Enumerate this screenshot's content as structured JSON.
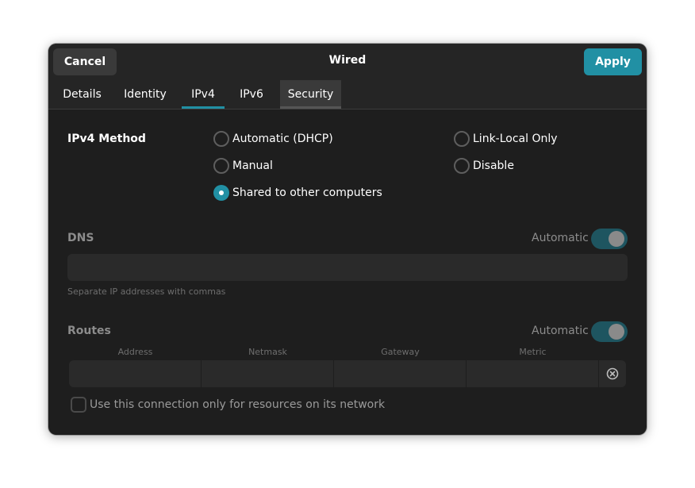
{
  "window": {
    "title": "Wired",
    "cancel_label": "Cancel",
    "apply_label": "Apply"
  },
  "tabs": [
    {
      "label": "Details"
    },
    {
      "label": "Identity"
    },
    {
      "label": "IPv4"
    },
    {
      "label": "IPv6"
    },
    {
      "label": "Security"
    }
  ],
  "ipv4_method": {
    "label": "IPv4 Method",
    "options": [
      {
        "label": "Automatic (DHCP)",
        "checked": false
      },
      {
        "label": "Manual",
        "checked": false
      },
      {
        "label": "Shared to other computers",
        "checked": true
      },
      {
        "label": "Link-Local Only",
        "checked": false
      },
      {
        "label": "Disable",
        "checked": false
      }
    ]
  },
  "dns": {
    "label": "DNS",
    "auto_label": "Automatic",
    "auto_on": true,
    "value": "",
    "hint": "Separate IP addresses with commas"
  },
  "routes": {
    "label": "Routes",
    "auto_label": "Automatic",
    "auto_on": true,
    "columns": [
      "Address",
      "Netmask",
      "Gateway",
      "Metric"
    ],
    "row": [
      "",
      "",
      "",
      ""
    ]
  },
  "only_local": {
    "label": "Use this connection only for resources on its network",
    "checked": false
  },
  "colors": {
    "accent": "#2190a4",
    "background": "#1e1e1e",
    "header": "#252525"
  }
}
